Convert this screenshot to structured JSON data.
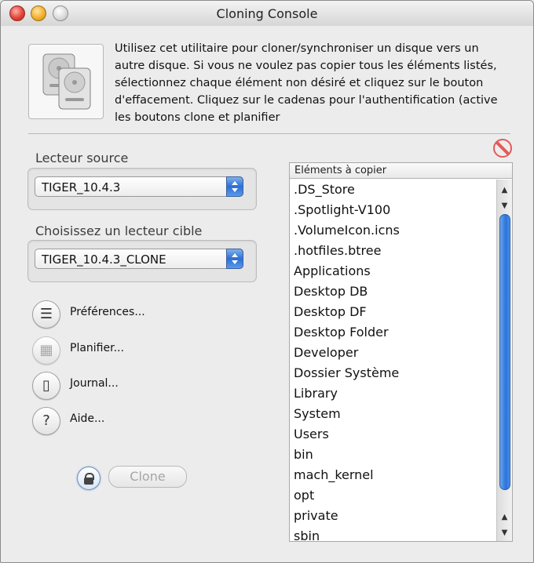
{
  "window": {
    "title": "Cloning Console"
  },
  "intro": {
    "text": "Utilisez cet utilitaire pour cloner/synchroniser un disque vers un autre disque. Si vous ne voulez pas copier tous les éléments listés, sélectionnez chaque élément non désiré et cliquez sur le bouton d'effacement. Cliquez sur le cadenas pour l'authentification (active les boutons clone et planifier"
  },
  "source": {
    "label": "Lecteur source",
    "value": "TIGER_10.4.3"
  },
  "target": {
    "label": "Choisissez un lecteur cible",
    "value": "TIGER_10.4.3_CLONE"
  },
  "actions": [
    {
      "label": "Préférences...",
      "icon": "list-icon",
      "enabled": true
    },
    {
      "label": "Planifier...",
      "icon": "calendar-icon",
      "enabled": false
    },
    {
      "label": "Journal...",
      "icon": "document-icon",
      "enabled": true
    },
    {
      "label": "Aide...",
      "icon": "help-icon",
      "enabled": true
    }
  ],
  "clone_button": {
    "label": "Clone",
    "enabled": false
  },
  "items_list": {
    "header": "Eléments à copier",
    "items": [
      ".DS_Store",
      ".Spotlight-V100",
      ".VolumeIcon.icns",
      ".hotfiles.btree",
      "Applications",
      "Desktop DB",
      "Desktop DF",
      "Desktop Folder",
      "Developer",
      "Dossier Système",
      "Library",
      "System",
      "Users",
      "bin",
      "mach_kernel",
      "opt",
      "private",
      "sbin"
    ]
  },
  "colors": {
    "accent": "#2c6fd3",
    "erase": "#e35a5a"
  }
}
